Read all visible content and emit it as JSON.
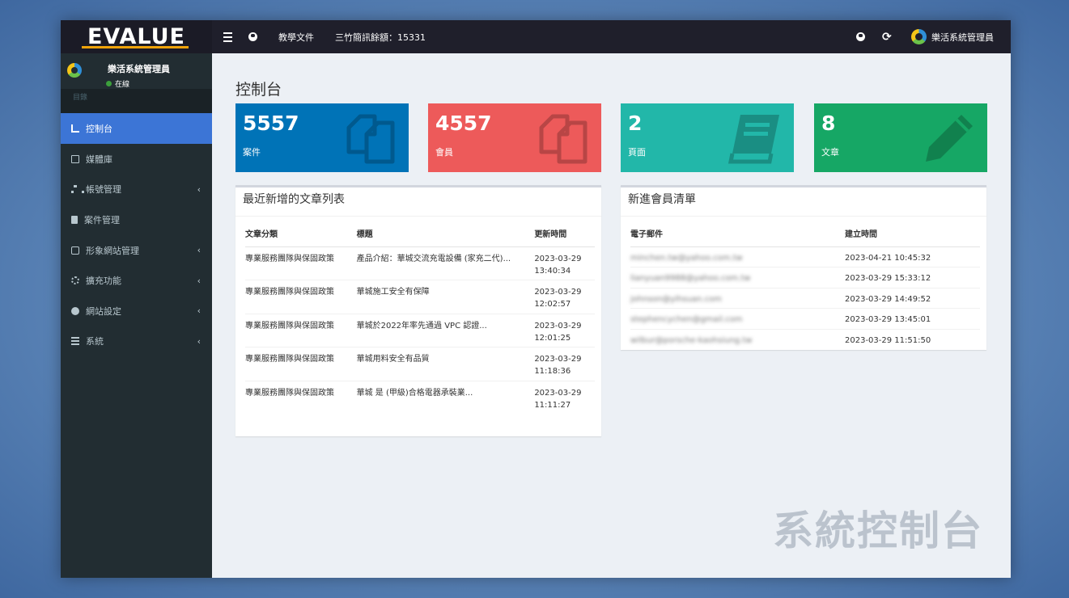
{
  "app": {
    "logo_text": "EVALUE",
    "top_nav": {
      "docs": "教學文件",
      "sms_balance": "三竹簡訊餘額：15331",
      "user_name": "樂活系統管理員"
    },
    "icons": [
      "menu-icon",
      "globe-icon",
      "chrome-icon",
      "refresh-icon"
    ]
  },
  "sidebar": {
    "user": {
      "name": "樂活系統管理員",
      "status": "在線"
    },
    "header": "目錄",
    "items": [
      {
        "label": "控制台",
        "icon": "bar-chart-icon",
        "active": true,
        "has_caret": false
      },
      {
        "label": "媒體庫",
        "icon": "image-icon",
        "active": false,
        "has_caret": false
      },
      {
        "label": "帳號管理",
        "icon": "sitemap-icon",
        "active": false,
        "has_caret": true
      },
      {
        "label": "案件管理",
        "icon": "book-icon",
        "active": false,
        "has_caret": false
      },
      {
        "label": "形象網站管理",
        "icon": "clone-icon",
        "active": false,
        "has_caret": true
      },
      {
        "label": "擴充功能",
        "icon": "cogs-icon",
        "active": false,
        "has_caret": true
      },
      {
        "label": "網站設定",
        "icon": "globe-icon",
        "active": false,
        "has_caret": true
      },
      {
        "label": "系統",
        "icon": "server-icon",
        "active": false,
        "has_caret": true
      }
    ],
    "caret": "‹"
  },
  "main": {
    "title": "控制台",
    "info_boxes": [
      {
        "number": "5557",
        "label": "案件",
        "color": "#0073b7",
        "icon": "copy-icon"
      },
      {
        "number": "4557",
        "label": "會員",
        "color": "#ed5a5a",
        "icon": "copy-icon"
      },
      {
        "number": "2",
        "label": "頁面",
        "color": "#22b7a9",
        "icon": "book-icon"
      },
      {
        "number": "8",
        "label": "文章",
        "color": "#16a765",
        "icon": "pencil-icon"
      }
    ],
    "articles": {
      "title": "最近新增的文章列表",
      "headers": [
        "文章分類",
        "標題",
        "更新時間"
      ],
      "rows": [
        {
          "category": "專業服務團隊與保固政策",
          "title": "產品介紹：華城交流充電設備 (家充二代)...",
          "updated": "2023-03-29 13:40:34"
        },
        {
          "category": "專業服務團隊與保固政策",
          "title": "華城施工安全有保障",
          "updated": "2023-03-29 12:02:57"
        },
        {
          "category": "專業服務團隊與保固政策",
          "title": "華城於2022年率先通過 VPC 認證...",
          "updated": "2023-03-29 12:01:25"
        },
        {
          "category": "專業服務團隊與保固政策",
          "title": "華城用料安全有品質",
          "updated": "2023-03-29 11:18:36"
        },
        {
          "category": "專業服務團隊與保固政策",
          "title": "華城 是 (甲級)合格電器承裝業...",
          "updated": "2023-03-29 11:11:27"
        }
      ]
    },
    "members": {
      "title": "新進會員清單",
      "headers": [
        "電子郵件",
        "建立時間"
      ],
      "rows": [
        {
          "email": "minchen.tw@yahoo.com.tw",
          "created": "2023-04-21 10:45:32"
        },
        {
          "email": "lianyuan9988@yahoo.com.tw",
          "created": "2023-03-29 15:33:12"
        },
        {
          "email": "johnson@yihsuan.com",
          "created": "2023-03-29 14:49:52"
        },
        {
          "email": "stephencychen@gmail.com",
          "created": "2023-03-29 13:45:01"
        },
        {
          "email": "wilbur@porsche-kaohsiung.tw",
          "created": "2023-03-29 11:51:50"
        }
      ]
    },
    "watermark": "系統控制台"
  }
}
